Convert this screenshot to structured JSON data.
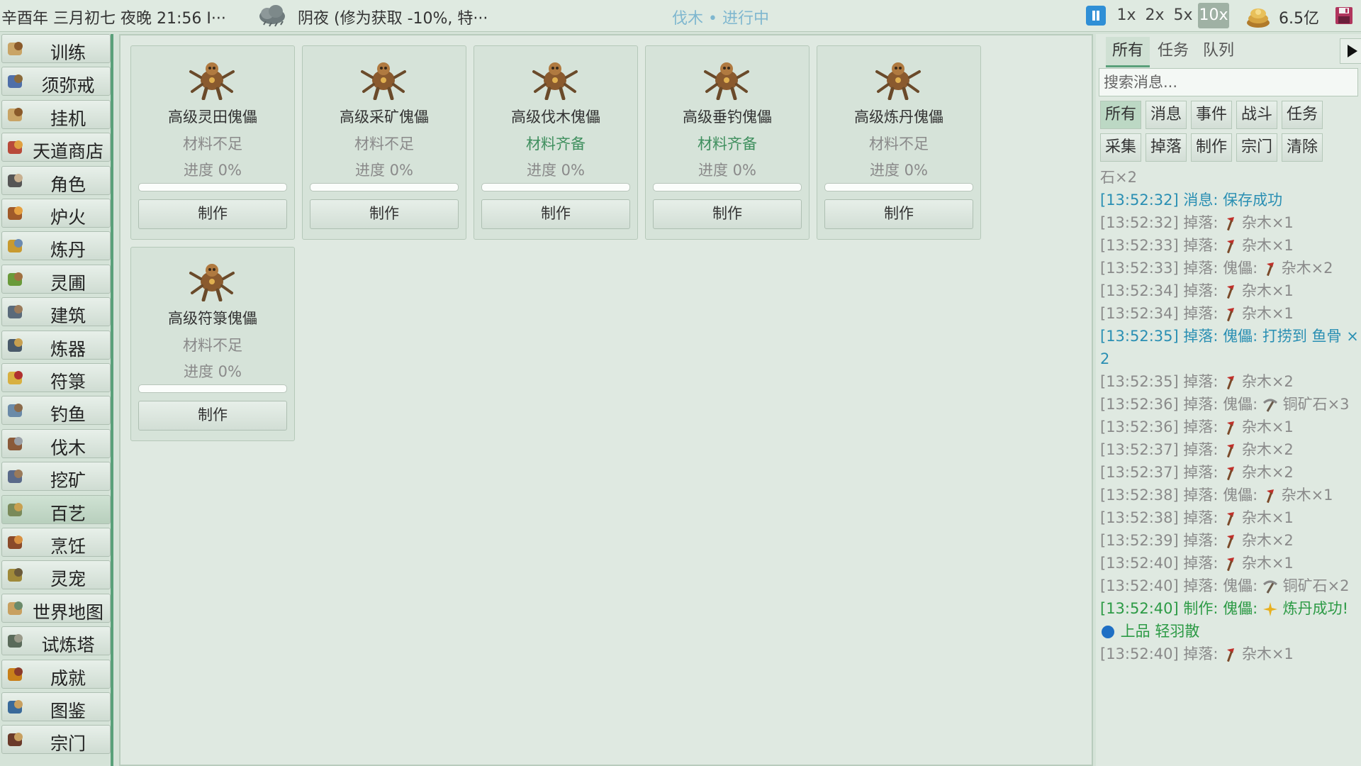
{
  "topbar": {
    "date_time": "辛酉年 三月初七 夜晚 21:56  I···",
    "weather": "阴夜 (修为获取 -10%, 特···",
    "status": "伐木 • 进行中",
    "speeds": [
      "1x",
      "2x",
      "5x",
      "10x"
    ],
    "active_speed": "10x",
    "coins": "6.5亿"
  },
  "sidebar": {
    "active": "百艺",
    "items": [
      {
        "label": "训练",
        "icon": "scroll-icon"
      },
      {
        "label": "须弥戒",
        "icon": "pouch-icon"
      },
      {
        "label": "挂机",
        "icon": "scroll-icon"
      },
      {
        "label": "天道商店",
        "icon": "shop-icon"
      },
      {
        "label": "角色",
        "icon": "character-icon"
      },
      {
        "label": "炉火",
        "icon": "furnace-icon"
      },
      {
        "label": "炼丹",
        "icon": "cauldron-icon"
      },
      {
        "label": "灵圃",
        "icon": "garden-icon"
      },
      {
        "label": "建筑",
        "icon": "building-icon"
      },
      {
        "label": "炼器",
        "icon": "anvil-icon"
      },
      {
        "label": "符箓",
        "icon": "talisman-icon"
      },
      {
        "label": "钓鱼",
        "icon": "fishing-icon"
      },
      {
        "label": "伐木",
        "icon": "axe-icon"
      },
      {
        "label": "挖矿",
        "icon": "pickaxe-icon"
      },
      {
        "label": "百艺",
        "icon": "crafts-icon"
      },
      {
        "label": "烹饪",
        "icon": "cooking-icon"
      },
      {
        "label": "灵宠",
        "icon": "pet-icon"
      },
      {
        "label": "世界地图",
        "icon": "map-icon"
      },
      {
        "label": "试炼塔",
        "icon": "tower-icon"
      },
      {
        "label": "成就",
        "icon": "trophy-icon"
      },
      {
        "label": "图鉴",
        "icon": "book-icon"
      },
      {
        "label": "宗门",
        "icon": "sect-icon"
      }
    ]
  },
  "cards": [
    {
      "name": "高级灵田傀儡",
      "status": "材料不足",
      "ready": false,
      "progress_text": "进度 0%",
      "progress": 0,
      "button": "制作",
      "icon": "field-puppet-icon"
    },
    {
      "name": "高级采矿傀儡",
      "status": "材料不足",
      "ready": false,
      "progress_text": "进度 0%",
      "progress": 0,
      "button": "制作",
      "icon": "mining-puppet-icon"
    },
    {
      "name": "高级伐木傀儡",
      "status": "材料齐备",
      "ready": true,
      "progress_text": "进度 0%",
      "progress": 0,
      "button": "制作",
      "icon": "logging-puppet-icon"
    },
    {
      "name": "高级垂钓傀儡",
      "status": "材料齐备",
      "ready": true,
      "progress_text": "进度 0%",
      "progress": 0,
      "button": "制作",
      "icon": "fishing-puppet-icon"
    },
    {
      "name": "高级炼丹傀儡",
      "status": "材料不足",
      "ready": false,
      "progress_text": "进度 0%",
      "progress": 0,
      "button": "制作",
      "icon": "alchemy-puppet-icon"
    },
    {
      "name": "高级符箓傀儡",
      "status": "材料不足",
      "ready": false,
      "progress_text": "进度 0%",
      "progress": 0,
      "button": "制作",
      "icon": "talisman-puppet-icon"
    }
  ],
  "log": {
    "tabs": [
      "所有",
      "任务",
      "队列"
    ],
    "active_tab": "所有",
    "search_placeholder": "搜索消息...",
    "filters_row1": [
      "所有",
      "消息",
      "事件",
      "战斗",
      "任务"
    ],
    "filters_row2": [
      "采集",
      "掉落",
      "制作",
      "宗门",
      "清除"
    ],
    "active_filter": "所有",
    "lines": [
      {
        "type": "drop",
        "text": "石×2"
      },
      {
        "type": "info",
        "text": "[13:52:32] 消息: 保存成功"
      },
      {
        "type": "drop",
        "icon": "axe",
        "pre": "[13:52:32] 掉落: ",
        "post": " 杂木×1"
      },
      {
        "type": "drop",
        "icon": "axe",
        "pre": "[13:52:33] 掉落: ",
        "post": " 杂木×1"
      },
      {
        "type": "drop",
        "icon": "axe",
        "pre": "[13:52:33] 掉落: 傀儡: ",
        "post": " 杂木×2"
      },
      {
        "type": "drop",
        "icon": "axe",
        "pre": "[13:52:34] 掉落: ",
        "post": " 杂木×1"
      },
      {
        "type": "drop",
        "icon": "axe",
        "pre": "[13:52:34] 掉落: ",
        "post": " 杂木×1"
      },
      {
        "type": "info",
        "text": "[13:52:35] 掉落: 傀儡: 打捞到 鱼骨 ×2"
      },
      {
        "type": "drop",
        "icon": "axe",
        "pre": "[13:52:35] 掉落: ",
        "post": " 杂木×2"
      },
      {
        "type": "drop",
        "icon": "pick",
        "pre": "[13:52:36] 掉落: 傀儡: ",
        "post": " 铜矿石×3"
      },
      {
        "type": "drop",
        "icon": "axe",
        "pre": "[13:52:36] 掉落: ",
        "post": " 杂木×1"
      },
      {
        "type": "drop",
        "icon": "axe",
        "pre": "[13:52:37] 掉落: ",
        "post": " 杂木×2"
      },
      {
        "type": "drop",
        "icon": "axe",
        "pre": "[13:52:37] 掉落: ",
        "post": " 杂木×2"
      },
      {
        "type": "drop",
        "icon": "axe",
        "pre": "[13:52:38] 掉落: 傀儡: ",
        "post": " 杂木×1"
      },
      {
        "type": "drop",
        "icon": "axe",
        "pre": "[13:52:38] 掉落: ",
        "post": " 杂木×1"
      },
      {
        "type": "drop",
        "icon": "axe",
        "pre": "[13:52:39] 掉落: ",
        "post": " 杂木×2"
      },
      {
        "type": "drop",
        "icon": "axe",
        "pre": "[13:52:40] 掉落: ",
        "post": " 杂木×1"
      },
      {
        "type": "drop",
        "icon": "pick",
        "pre": "[13:52:40] 掉落: 傀儡: ",
        "post": " 铜矿石×2"
      },
      {
        "type": "craft",
        "icon": "spark",
        "pre": "[13:52:40] 制作: 傀儡: ",
        "post": " 炼丹成功! ",
        "icon2": "orb",
        "post2": " 上品 轻羽散"
      },
      {
        "type": "drop",
        "icon": "axe",
        "pre": "[13:52:40] 掉落: ",
        "post": " 杂木×1"
      }
    ]
  },
  "colors": {
    "accent": "#5aa07a",
    "ready": "#3f8f5e",
    "info": "#2a8fb3",
    "craft": "#2c9a45",
    "muted": "#8a8a8a"
  }
}
